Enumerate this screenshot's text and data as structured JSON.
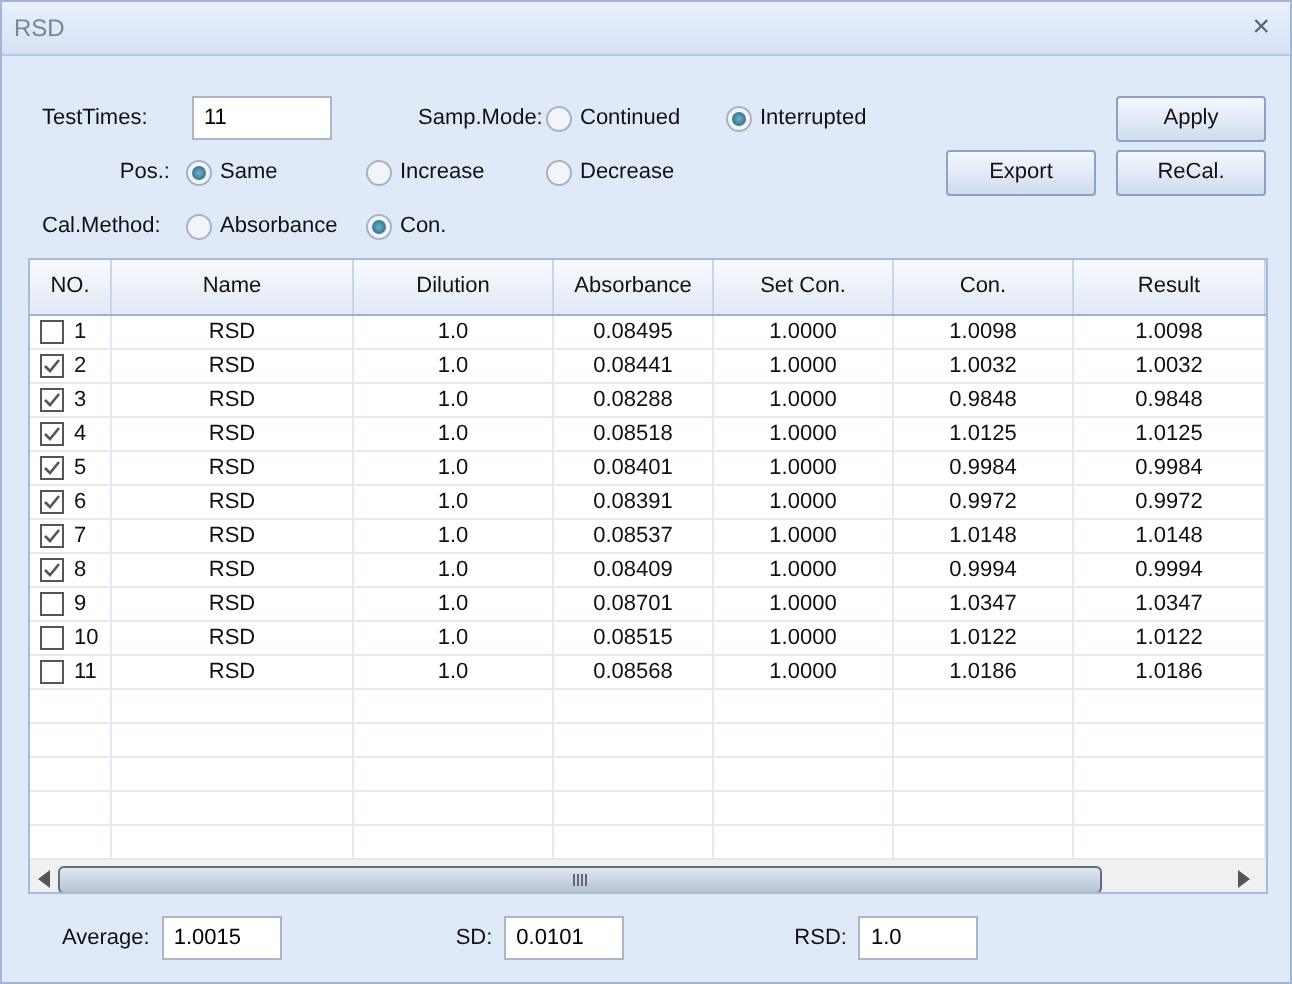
{
  "window": {
    "title": "RSD",
    "close": "×"
  },
  "test_times": {
    "label": "TestTimes:",
    "value": "11"
  },
  "samp_mode": {
    "label": "Samp.Mode:",
    "options": [
      {
        "label": "Continued",
        "selected": false
      },
      {
        "label": "Interrupted",
        "selected": true
      }
    ]
  },
  "pos": {
    "label": "Pos.:",
    "options": [
      {
        "label": "Same",
        "selected": true
      },
      {
        "label": "Increase",
        "selected": false
      },
      {
        "label": "Decrease",
        "selected": false
      }
    ]
  },
  "cal_method": {
    "label": "Cal.Method:",
    "options": [
      {
        "label": "Absorbance",
        "selected": false
      },
      {
        "label": "Con.",
        "selected": true
      }
    ]
  },
  "buttons": [
    "Apply",
    "Export",
    "ReCal."
  ],
  "table": {
    "columns": [
      "NO.",
      "Name",
      "Dilution",
      "Absorbance",
      "Set Con.",
      "Con.",
      "Result"
    ],
    "rows": [
      {
        "checked": false,
        "cells": [
          "1",
          "RSD",
          "1.0",
          "0.08495",
          "1.0000",
          "1.0098",
          "1.0098"
        ]
      },
      {
        "checked": true,
        "cells": [
          "2",
          "RSD",
          "1.0",
          "0.08441",
          "1.0000",
          "1.0032",
          "1.0032"
        ]
      },
      {
        "checked": true,
        "cells": [
          "3",
          "RSD",
          "1.0",
          "0.08288",
          "1.0000",
          "0.9848",
          "0.9848"
        ]
      },
      {
        "checked": true,
        "cells": [
          "4",
          "RSD",
          "1.0",
          "0.08518",
          "1.0000",
          "1.0125",
          "1.0125"
        ]
      },
      {
        "checked": true,
        "cells": [
          "5",
          "RSD",
          "1.0",
          "0.08401",
          "1.0000",
          "0.9984",
          "0.9984"
        ]
      },
      {
        "checked": true,
        "cells": [
          "6",
          "RSD",
          "1.0",
          "0.08391",
          "1.0000",
          "0.9972",
          "0.9972"
        ]
      },
      {
        "checked": true,
        "cells": [
          "7",
          "RSD",
          "1.0",
          "0.08537",
          "1.0000",
          "1.0148",
          "1.0148"
        ]
      },
      {
        "checked": true,
        "cells": [
          "8",
          "RSD",
          "1.0",
          "0.08409",
          "1.0000",
          "0.9994",
          "0.9994"
        ]
      },
      {
        "checked": false,
        "cells": [
          "9",
          "RSD",
          "1.0",
          "0.08701",
          "1.0000",
          "1.0347",
          "1.0347"
        ]
      },
      {
        "checked": false,
        "cells": [
          "10",
          "RSD",
          "1.0",
          "0.08515",
          "1.0000",
          "1.0122",
          "1.0122"
        ]
      },
      {
        "checked": false,
        "cells": [
          "11",
          "RSD",
          "1.0",
          "0.08568",
          "1.0000",
          "1.0186",
          "1.0186"
        ]
      }
    ]
  },
  "summary": [
    {
      "label": "Average:",
      "value": "1.0015"
    },
    {
      "label": "SD:",
      "value": "0.0101"
    },
    {
      "label": "RSD:",
      "value": "1.0"
    }
  ]
}
